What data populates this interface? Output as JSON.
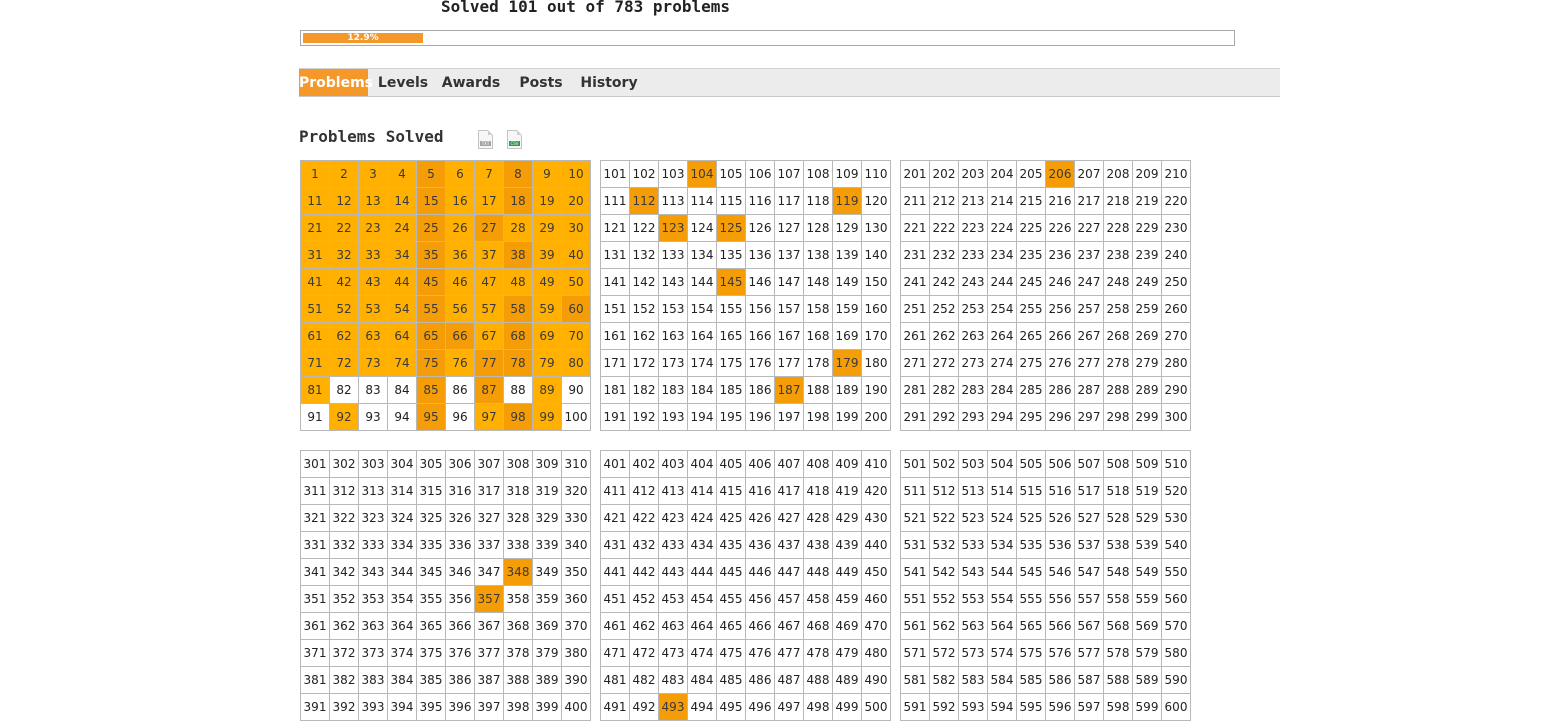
{
  "summary": "Solved 101 out of 783 problems",
  "progress": {
    "label": "12.9%",
    "fraction": 0.129
  },
  "tabs": [
    {
      "label": "Problems",
      "active": true
    },
    {
      "label": "Levels",
      "active": false
    },
    {
      "label": "Awards",
      "active": false
    },
    {
      "label": "Posts",
      "active": false
    },
    {
      "label": "History",
      "active": false
    }
  ],
  "section_title": "Problems Solved",
  "downloads": [
    {
      "icon": "txt-file-icon",
      "tag": "TXT"
    },
    {
      "icon": "csv-file-icon",
      "tag": "CSV"
    }
  ],
  "colors": {
    "accent": "#f5982a",
    "solved": "#ffb000",
    "solved_alt": "#f59d07"
  },
  "grid": {
    "blocks": [
      {
        "start": 1,
        "rows": 10,
        "cols": 10
      },
      {
        "start": 101,
        "rows": 10,
        "cols": 10
      },
      {
        "start": 201,
        "rows": 10,
        "cols": 10
      },
      {
        "start": 301,
        "rows": 10,
        "cols": 10
      },
      {
        "start": 401,
        "rows": 10,
        "cols": 10
      },
      {
        "start": 501,
        "rows": 10,
        "cols": 10
      }
    ],
    "solved": [
      1,
      2,
      3,
      4,
      5,
      6,
      7,
      8,
      9,
      10,
      11,
      12,
      13,
      14,
      15,
      16,
      17,
      18,
      19,
      20,
      21,
      22,
      23,
      24,
      25,
      26,
      27,
      28,
      29,
      30,
      31,
      32,
      33,
      34,
      35,
      36,
      37,
      38,
      39,
      40,
      41,
      42,
      43,
      44,
      45,
      46,
      47,
      48,
      49,
      50,
      51,
      52,
      53,
      54,
      55,
      56,
      57,
      58,
      59,
      60,
      61,
      62,
      63,
      64,
      65,
      66,
      67,
      68,
      69,
      70,
      71,
      72,
      73,
      74,
      75,
      76,
      77,
      78,
      79,
      80,
      81,
      85,
      87,
      89,
      92,
      95,
      97,
      98,
      99,
      104,
      112,
      119,
      123,
      125,
      145,
      179,
      187,
      206,
      348,
      357,
      493
    ],
    "solved_alt": [
      5,
      8,
      15,
      18,
      25,
      27,
      35,
      38,
      45,
      55,
      58,
      60,
      65,
      66,
      68,
      75,
      77,
      78,
      85,
      87,
      95,
      98,
      104,
      112,
      119,
      123,
      125,
      145,
      179,
      187,
      206,
      348,
      357,
      493
    ]
  }
}
